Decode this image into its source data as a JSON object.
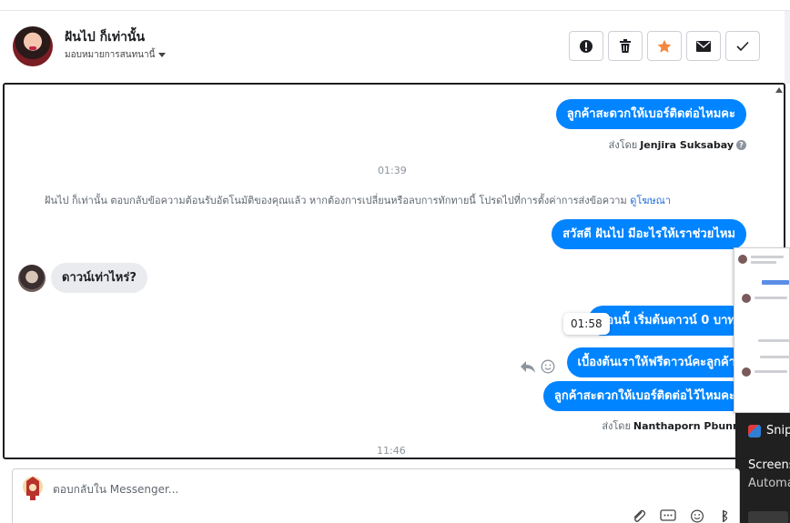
{
  "header": {
    "contact_name": "ฝันไป ก็เท่านั้น",
    "assign_label": "มอบหมายการสนทนานี้",
    "actions": [
      {
        "icon": "alert-icon",
        "color": "#1c1e21"
      },
      {
        "icon": "trash-icon",
        "color": "#1c1e21"
      },
      {
        "icon": "star-icon",
        "color": "#f5883e"
      },
      {
        "icon": "mail-icon",
        "color": "#1c1e21"
      },
      {
        "icon": "check-icon",
        "color": "#1c1e21"
      }
    ]
  },
  "conversation": {
    "msg1": "ลูกค้าสะดวกให้เบอร์ติดต่อไหมคะ",
    "sent_by_prefix": "ส่งโดย",
    "sender1": "Jenjira Suksabay",
    "time1": "01:39",
    "system_message": "ฝันไป ก็เท่านั้น ตอบกลับข้อความต้อนรับอัตโนมัติของคุณแล้ว หากต้องการเปลี่ยนหรือลบการทักทายนี้ โปรดไปที่การตั้งค่าการส่งข้อความ",
    "system_link": "ดูโฆษณา",
    "msg2": "สวัสดี ฝันไป มีอะไรให้เราช่วยไหม",
    "incoming1": "ดาวน์เท่าไหร่?",
    "msg3": "ตอนนี้ เริ่มต้นดาวน์ 0 บาท",
    "tooltip_time": "01:58",
    "msg4": "เบื้องต้นเราให้ฟรีดาวน์คะลูกค้า",
    "msg5": "ลูกค้าสะดวกให้เบอร์ติดต่อไว้ไหมคะ",
    "sender2": "Nanthaporn Pbunny",
    "time2": "11:46"
  },
  "overlay": {
    "snip_label": "Snip",
    "screenshot_label": "Screens",
    "auto_label": "Automa"
  },
  "reply": {
    "placeholder": "ตอบกลับใน Messenger..."
  },
  "colors": {
    "accent": "#0084ff",
    "star": "#f5883e"
  }
}
